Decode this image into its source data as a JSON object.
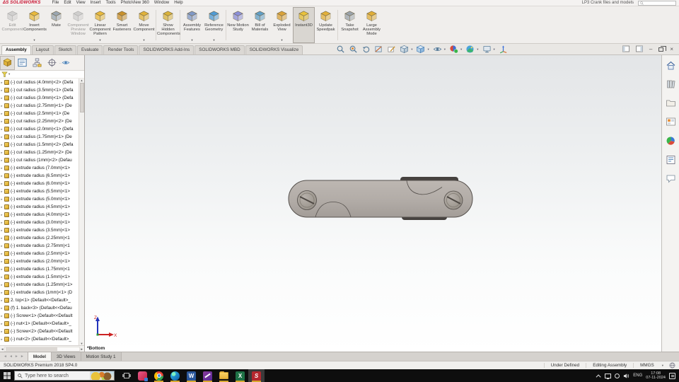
{
  "titlebar": {
    "logo": "ΔS SOLIDWORKS",
    "menus": [
      "File",
      "Edit",
      "View",
      "Insert",
      "Tools",
      "PhotoView 360",
      "Window",
      "Help"
    ],
    "doc_title": "LP3 Crank files and models"
  },
  "ribbon": {
    "groups": [
      [
        {
          "label": "Edit Component",
          "icon": "edit-component",
          "color": "#9fb4c4",
          "disabled": true
        },
        {
          "label": "Insert Components",
          "icon": "insert-components",
          "color": "#e8b93c",
          "dropdown": true
        },
        {
          "label": "Mate",
          "icon": "mate",
          "color": "#9aa6b2"
        },
        {
          "label": "Component Preview Window",
          "icon": "component-preview-window",
          "color": "#a7b2bc",
          "disabled": true
        },
        {
          "label": "Linear Component Pattern",
          "icon": "linear-component-pattern",
          "color": "#e8b93c",
          "dropdown": true
        },
        {
          "label": "Smart Fasteners",
          "icon": "smart-fasteners",
          "color": "#c8902c"
        },
        {
          "label": "Move Component",
          "icon": "move-component",
          "color": "#e0b23a",
          "dropdown": true
        }
      ],
      [
        {
          "label": "Show Hidden Components",
          "icon": "show-hidden-components",
          "color": "#d9b23a"
        }
      ],
      [
        {
          "label": "Assembly Features",
          "icon": "assembly-features",
          "color": "#7f98c6",
          "dropdown": true
        },
        {
          "label": "Reference Geometry",
          "icon": "reference-geometry",
          "color": "#4f9bd5",
          "dropdown": true
        }
      ],
      [
        {
          "label": "New Motion Study",
          "icon": "new-motion-study",
          "color": "#8b8fd9"
        },
        {
          "label": "Bill of Materials",
          "icon": "bill-of-materials",
          "color": "#5f9ec7"
        },
        {
          "label": "Exploded View",
          "icon": "exploded-view",
          "color": "#d9a23a",
          "dropdown": true
        },
        {
          "label": "Instant3D",
          "icon": "instant3d",
          "color": "#e8c23c",
          "active": true
        },
        {
          "label": "Update Speedpak",
          "icon": "update-speedpak",
          "color": "#e2b03a"
        }
      ],
      [
        {
          "label": "Take Snapshot",
          "icon": "take-snapshot",
          "color": "#9aa3ab"
        },
        {
          "label": "Large Assembly Mode",
          "icon": "large-assembly-mode",
          "color": "#e0ae38"
        }
      ]
    ]
  },
  "command_tabs": [
    {
      "label": "Assembly",
      "active": true
    },
    {
      "label": "Layout"
    },
    {
      "label": "Sketch"
    },
    {
      "label": "Evaluate"
    },
    {
      "label": "Render Tools"
    },
    {
      "label": "SOLIDWORKS Add-Ins"
    },
    {
      "label": "SOLIDWORKS MBD"
    },
    {
      "label": "SOLIDWORKS Visualize"
    }
  ],
  "headsup_icons": [
    "zoom-to-fit",
    "zoom-to-area",
    "previous-view",
    "section-view",
    "annotation-views",
    "view-orientation",
    "display-style",
    "hide-show-items",
    "edit-appearance",
    "apply-scene",
    "view-settings",
    "3d-drawing-view"
  ],
  "window_controls": [
    "collapse-pane",
    "display-pane",
    "minimize",
    "restore",
    "close"
  ],
  "feature_tree": {
    "tab_icons": [
      "featuremanager-tree",
      "propertymanager",
      "configurationmanager",
      "dimxpertmanager",
      "displaymanager"
    ],
    "items": [
      "(-) cut radius (4.0mm)<2> (Defa",
      "(-) cut radius (3.5mm)<1> (Defa",
      "(-) cut radius (3.0mm)<1> (Defa",
      "(-) cut radius (2.75mm)<1> (De",
      "(-) cut radius (2.5mm)<1> (De",
      "(-) cut radius (2.25mm)<2> (De",
      "(-) cut radius (2.0mm)<1> (Defa",
      "(-) cut radius (1.75mm)<1> (De",
      "(-) cut radius (1.5mm)<2> (Defa",
      "(-) cut radius (1.25mm)<2> (De",
      "(-) cut radius (1mm)<2> (Defau",
      "(-) extrude radius (7.0mm)<1>",
      "(-) extrude radius (6.5mm)<1>",
      "(-) extrude radius (6.0mm)<1>",
      "(-) extrude radius (5.5mm)<1>",
      "(-) extrude radius (5.0mm)<1>",
      "(-) extrude radius (4.5mm)<1>",
      "(-) extrude radius (4.0mm)<1>",
      "(-) extrude radius (3.0mm)<1>",
      "(-) extrude radius (3.5mm)<1>",
      "(-) extrude radius (2.25mm)<1",
      "(-) extrude radius (2.75mm)<1",
      "(-) extrude radius (2.5mm)<1>",
      "(-) extrude radius (2.0mm)<1>",
      "(-) extrude radius (1.75mm)<1",
      "(-) extrude radius (1.5mm)<1>",
      "(-) extrude radius (1.25mm)<1>",
      "(-) extrude radius (1mm)<1> (D",
      "2. top<1> (Default<<Default>_",
      "(f) 1. back<3> (Default<<Defau",
      "(-) Screw<1> (Default<<Default",
      "(-) nut<1> (Default<<Default>_",
      "(-) Screw<2> (Default<<Default",
      "(-) nut<2> (Default<<Default>_"
    ]
  },
  "viewport": {
    "orientation_label": "*Bottom",
    "triad": {
      "up": "Z",
      "right": "X"
    },
    "model_body_color": "#b3ada8"
  },
  "task_pane_icons": [
    "home",
    "design-library",
    "file-explorer",
    "view-palette",
    "appearances-scenes",
    "custom-properties",
    "solidworks-forum"
  ],
  "doc_tabs": [
    {
      "label": "Model",
      "active": true
    },
    {
      "label": "3D Views"
    },
    {
      "label": "Motion Study 1"
    }
  ],
  "statusbar": {
    "left": "SOLIDWORKS Premium 2018 SP4.0",
    "items": [
      "Under Defined",
      "Editing Assembly",
      "MMGS"
    ]
  },
  "taskbar": {
    "search_placeholder": "Type here to search",
    "apps": [
      "task-view",
      "red-app",
      "chrome",
      "edge",
      "word",
      "purple-app",
      "file-explorer",
      "excel",
      "solidworks"
    ],
    "tray": {
      "language": "ENG",
      "time": "17:08",
      "date": "07-11-2024"
    }
  },
  "colors": {
    "taskbar_accent": "#d7a72e",
    "tree_icon": "#e8b93c",
    "logo_red": "#c8102e"
  }
}
